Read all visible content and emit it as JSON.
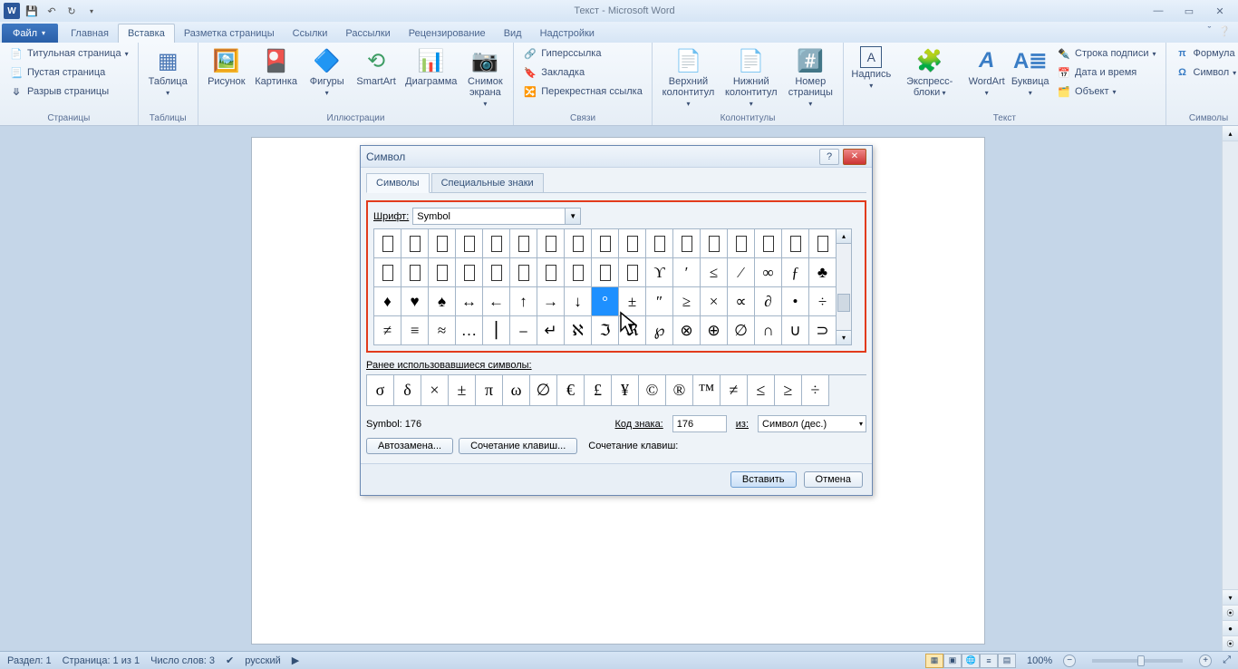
{
  "app": {
    "title": "Текст - Microsoft Word"
  },
  "tabs": {
    "file": "Файл",
    "home": "Главная",
    "insert": "Вставка",
    "layout": "Разметка страницы",
    "references": "Ссылки",
    "mailings": "Рассылки",
    "review": "Рецензирование",
    "view": "Вид",
    "addins": "Надстройки"
  },
  "ribbon": {
    "pages": {
      "label": "Страницы",
      "cover": "Титульная страница",
      "blank": "Пустая страница",
      "break": "Разрыв страницы"
    },
    "tables": {
      "label": "Таблицы",
      "table": "Таблица"
    },
    "illustrations": {
      "label": "Иллюстрации",
      "picture": "Рисунок",
      "clipart": "Картинка",
      "shapes": "Фигуры",
      "smartart": "SmartArt",
      "chart": "Диаграмма",
      "screenshot": "Снимок\nэкрана"
    },
    "links": {
      "label": "Связи",
      "hyperlink": "Гиперссылка",
      "bookmark": "Закладка",
      "crossref": "Перекрестная ссылка"
    },
    "headerfooter": {
      "label": "Колонтитулы",
      "header": "Верхний\nколонтитул",
      "footer": "Нижний\nколонтитул",
      "pagenum": "Номер\nстраницы"
    },
    "text": {
      "label": "Текст",
      "textbox": "Надпись",
      "quickparts": "Экспресс-блоки",
      "wordart": "WordArt",
      "dropcap": "Буквица",
      "sigline": "Строка подписи",
      "datetime": "Дата и время",
      "object": "Объект"
    },
    "symbols": {
      "label": "Символы",
      "equation": "Формула",
      "symbol": "Символ"
    }
  },
  "dialog": {
    "title": "Символ",
    "tab_symbols": "Символы",
    "tab_special": "Специальные знаки",
    "font_label": "Шрифт:",
    "font_value": "Symbol",
    "grid": {
      "row0": [
        "",
        "",
        "",
        "",
        "",
        "",
        "",
        "",
        "",
        "",
        "",
        "",
        "",
        "",
        "",
        ""
      ],
      "row1": [
        "",
        "",
        "",
        "",
        "",
        "",
        "",
        "",
        "",
        "",
        "ϒ",
        "′",
        "≤",
        "⁄",
        "∞",
        "ƒ",
        "♣"
      ],
      "row2": [
        "♦",
        "♥",
        "♠",
        "↔",
        "←",
        "↑",
        "→",
        "↓",
        "°",
        "±",
        "″",
        "≥",
        "×",
        "∝",
        "∂",
        "•",
        "÷"
      ],
      "row3": [
        "≠",
        "≡",
        "≈",
        "…",
        "⎮",
        "⎯",
        "↵",
        "ℵ",
        "ℑ",
        "ℜ",
        "℘",
        "⊗",
        "⊕",
        "∅",
        "∩",
        "∪",
        "⊃"
      ]
    },
    "selected_index": {
      "row": 2,
      "col": 8
    },
    "recent_label": "Ранее использовавшиеся символы:",
    "recent": [
      "σ",
      "δ",
      "×",
      "±",
      "π",
      "ω",
      "∅",
      "€",
      "£",
      "¥",
      "©",
      "®",
      "™",
      "≠",
      "≤",
      "≥",
      "÷"
    ],
    "symbol_name": "Symbol: 176",
    "code_label": "Код знака:",
    "code_value": "176",
    "from_label": "из:",
    "from_value": "Символ (дес.)",
    "autocorrect": "Автозамена...",
    "shortcut_btn": "Сочетание клавиш...",
    "shortcut_label": "Сочетание клавиш:",
    "insert": "Вставить",
    "cancel": "Отмена"
  },
  "statusbar": {
    "section": "Раздел: 1",
    "page": "Страница: 1 из 1",
    "words": "Число слов: 3",
    "language": "русский",
    "zoom": "100%"
  }
}
